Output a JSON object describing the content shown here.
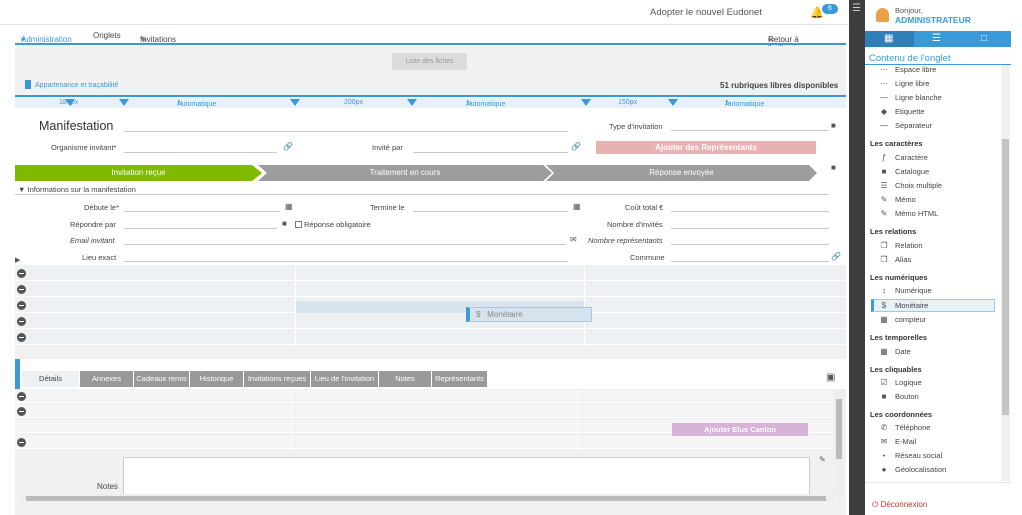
{
  "header": {
    "adopt_text": "Adopter le nouvel Eudonet",
    "notif_count": "6"
  },
  "nav": {
    "admin": "Administration",
    "onglets": "Onglets",
    "invitations": "Invitations reçues",
    "retour": "Retour à l'utilisation"
  },
  "toolbar": {
    "liste": "Liste des fiches",
    "appartenance": "Appartenance et traçabilité",
    "rubriques": "51 rubriques libres disponibles"
  },
  "ruler": {
    "col1": "184px",
    "auto1": "Automatique",
    "col2": "200px",
    "auto2": "Automatique",
    "col3": "150px",
    "auto3": "Automatique"
  },
  "form": {
    "title": "Manifestation",
    "type_invitation": "Type d'invitation",
    "organisme": "Organisme invitant*",
    "invite_par": "Invité par",
    "btn_representants": "Ajouter des Représentants",
    "steps": [
      "Invitation reçue",
      "Traitement en cours",
      "Réponse envoyée"
    ],
    "section": "Informations sur la manifestation",
    "debute": "Débute le*",
    "termine": "Termine le",
    "cout": "Coût total €",
    "repondre": "Répondre par",
    "reponse_oblig": "Réponse obligatoire",
    "nb_invites": "Nombre d'invités",
    "email": "Email invitant",
    "nb_repr": "Nombre représentants",
    "lieu": "Lieu exact",
    "commune": "Commune",
    "monetaire": "Monétaire"
  },
  "tabs": [
    "Détails",
    "Annexes",
    "Cadeaux remis",
    "Historique",
    "Invitations reçues",
    "Lieu de l'invitation",
    "Notes",
    "Représentants"
  ],
  "bottom": {
    "btn_elus": "Ajouter Elus Canton",
    "notes": "Notes"
  },
  "panel": {
    "bonjour": "Bonjour,",
    "user": "ADMINISTRATEUR",
    "contenu": "Contenu de l'onglet",
    "items": [
      {
        "label": "Espace libre",
        "icon": "dots-icon"
      },
      {
        "label": "Ligne libre",
        "icon": "dots-icon"
      },
      {
        "label": "Ligne blanche",
        "icon": "dash-icon"
      },
      {
        "label": "Etiquette",
        "icon": "tag-icon"
      },
      {
        "label": "Séparateur",
        "icon": "dash-icon"
      }
    ],
    "sec_caracteres": "Les caractères",
    "caracteres": [
      {
        "label": "Caractère",
        "icon": "font-icon"
      },
      {
        "label": "Catalogue",
        "icon": "folder-icon"
      },
      {
        "label": "Choix multiple",
        "icon": "list-icon"
      },
      {
        "label": "Mémo",
        "icon": "edit-icon"
      },
      {
        "label": "Mémo HTML",
        "icon": "edit-icon"
      }
    ],
    "sec_relations": "Les relations",
    "relations": [
      {
        "label": "Relation",
        "icon": "copy-icon"
      },
      {
        "label": "Alias",
        "icon": "copy-icon"
      }
    ],
    "sec_numeriques": "Les numériques",
    "numeriques": [
      {
        "label": "Numérique",
        "icon": "sort-icon"
      },
      {
        "label": "Monétaire",
        "icon": "dollar-icon"
      },
      {
        "label": "compteur",
        "icon": "counter-icon"
      }
    ],
    "sec_temporelles": "Les temporelles",
    "temporelles": [
      {
        "label": "Date",
        "icon": "calendar-icon"
      }
    ],
    "sec_cliquables": "Les cliquables",
    "cliquables": [
      {
        "label": "Logique",
        "icon": "checkbox-icon"
      },
      {
        "label": "Bouton",
        "icon": "square-icon"
      }
    ],
    "sec_coordonnees": "Les coordonnées",
    "coordonnees": [
      {
        "label": "Téléphone",
        "icon": "phone-icon"
      },
      {
        "label": "E-Mail",
        "icon": "mail-icon"
      },
      {
        "label": "Réseau social",
        "icon": "share-icon"
      },
      {
        "label": "Géolocalisation",
        "icon": "pin-icon"
      }
    ],
    "deconnexion": "Déconnexion"
  },
  "colors": {
    "accent": "#3a9ad9",
    "step_active": "#7fba00",
    "step_inactive": "#9d9d9d",
    "btn_repr": "#e8b2b2",
    "btn_elus": "#d7b2d9"
  }
}
